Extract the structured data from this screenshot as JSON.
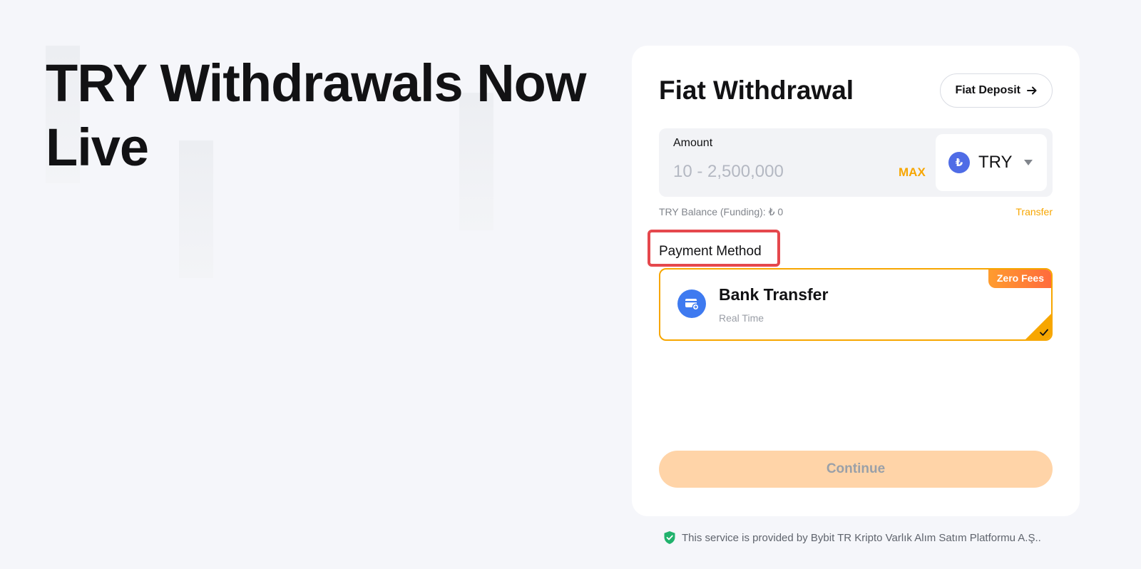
{
  "hero": {
    "title": "TRY Withdrawals Now Live"
  },
  "card": {
    "title": "Fiat Withdrawal",
    "deposit_button": "Fiat Deposit"
  },
  "amount": {
    "label": "Amount",
    "placeholder": "10 - 2,500,000",
    "max_label": "MAX",
    "currency": {
      "code": "TRY",
      "symbol": "₺",
      "icon": "lira-coin-icon"
    }
  },
  "balance": {
    "text": "TRY Balance (Funding): ₺ 0",
    "transfer_label": "Transfer"
  },
  "payment": {
    "section_label": "Payment Method",
    "option": {
      "title": "Bank Transfer",
      "subtitle": "Real Time",
      "badge": "Zero Fees",
      "selected": true,
      "icon": "bank-card-icon"
    }
  },
  "actions": {
    "continue_label": "Continue"
  },
  "footer": {
    "note": "This service is provided by Bybit TR Kripto Varlık Alım Satım Platformu A.Ş..",
    "icon": "shield-check-icon"
  },
  "colors": {
    "accent": "#f7a600",
    "highlight_border": "#e5484d",
    "coin": "#4f6ce6",
    "bank_icon": "#3e7af0",
    "shield": "#20b26c"
  }
}
